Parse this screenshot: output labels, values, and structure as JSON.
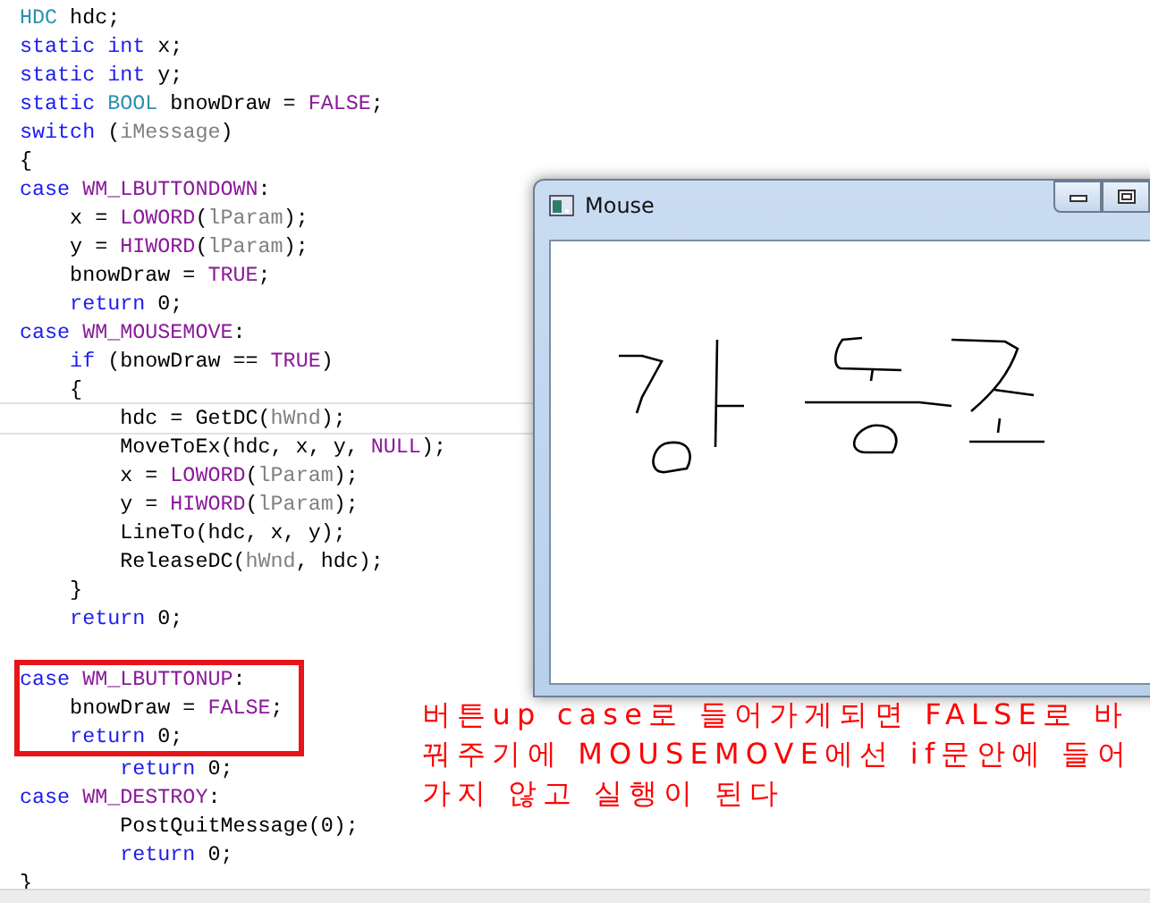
{
  "code": {
    "blocks": [
      {
        "kind": "plain",
        "lines": [
          {
            "current": false,
            "tokens": [
              {
                "kind": "type",
                "text": "HDC"
              },
              {
                "kind": "text",
                "text": " hdc;"
              }
            ]
          },
          {
            "current": false,
            "tokens": [
              {
                "kind": "kw",
                "text": "static int"
              },
              {
                "kind": "text",
                "text": " x;"
              }
            ]
          },
          {
            "current": false,
            "tokens": [
              {
                "kind": "kw",
                "text": "static int"
              },
              {
                "kind": "text",
                "text": " y;"
              }
            ]
          },
          {
            "current": false,
            "tokens": [
              {
                "kind": "kw",
                "text": "static "
              },
              {
                "kind": "type",
                "text": "BOOL"
              },
              {
                "kind": "text",
                "text": " bnowDraw = "
              },
              {
                "kind": "macro",
                "text": "FALSE"
              },
              {
                "kind": "text",
                "text": ";"
              }
            ]
          },
          {
            "current": false,
            "tokens": [
              {
                "kind": "kw",
                "text": "switch"
              },
              {
                "kind": "text",
                "text": " ("
              },
              {
                "kind": "param",
                "text": "iMessage"
              },
              {
                "kind": "text",
                "text": ")"
              }
            ]
          },
          {
            "current": false,
            "tokens": [
              {
                "kind": "text",
                "text": "{"
              }
            ]
          },
          {
            "current": false,
            "tokens": [
              {
                "kind": "kw",
                "text": "case "
              },
              {
                "kind": "macro",
                "text": "WM_LBUTTONDOWN"
              },
              {
                "kind": "text",
                "text": ":"
              }
            ]
          },
          {
            "current": false,
            "tokens": [
              {
                "kind": "text",
                "text": "    x = "
              },
              {
                "kind": "macro",
                "text": "LOWORD"
              },
              {
                "kind": "text",
                "text": "("
              },
              {
                "kind": "param",
                "text": "lParam"
              },
              {
                "kind": "text",
                "text": ");"
              }
            ]
          },
          {
            "current": false,
            "tokens": [
              {
                "kind": "text",
                "text": "    y = "
              },
              {
                "kind": "macro",
                "text": "HIWORD"
              },
              {
                "kind": "text",
                "text": "("
              },
              {
                "kind": "param",
                "text": "lParam"
              },
              {
                "kind": "text",
                "text": ");"
              }
            ]
          },
          {
            "current": false,
            "tokens": [
              {
                "kind": "text",
                "text": "    bnowDraw = "
              },
              {
                "kind": "macro",
                "text": "TRUE"
              },
              {
                "kind": "text",
                "text": ";"
              }
            ]
          },
          {
            "current": false,
            "tokens": [
              {
                "kind": "kw",
                "text": "    return"
              },
              {
                "kind": "text",
                "text": " 0;"
              }
            ]
          },
          {
            "current": false,
            "tokens": [
              {
                "kind": "kw",
                "text": "case "
              },
              {
                "kind": "macro",
                "text": "WM_MOUSEMOVE"
              },
              {
                "kind": "text",
                "text": ":"
              }
            ]
          },
          {
            "current": false,
            "tokens": [
              {
                "kind": "kw",
                "text": "    if"
              },
              {
                "kind": "text",
                "text": " (bnowDraw == "
              },
              {
                "kind": "macro",
                "text": "TRUE"
              },
              {
                "kind": "text",
                "text": ")"
              }
            ]
          },
          {
            "current": false,
            "tokens": [
              {
                "kind": "text",
                "text": "    {"
              }
            ]
          },
          {
            "current": true,
            "tokens": [
              {
                "kind": "text",
                "text": "        hdc = GetDC("
              },
              {
                "kind": "param",
                "text": "hWnd"
              },
              {
                "kind": "text",
                "text": ");"
              }
            ]
          },
          {
            "current": false,
            "tokens": [
              {
                "kind": "text",
                "text": "        MoveToEx(hdc, x, y, "
              },
              {
                "kind": "macro",
                "text": "NULL"
              },
              {
                "kind": "text",
                "text": ");"
              }
            ]
          },
          {
            "current": false,
            "tokens": [
              {
                "kind": "text",
                "text": "        x = "
              },
              {
                "kind": "macro",
                "text": "LOWORD"
              },
              {
                "kind": "text",
                "text": "("
              },
              {
                "kind": "param",
                "text": "lParam"
              },
              {
                "kind": "text",
                "text": ");"
              }
            ]
          },
          {
            "current": false,
            "tokens": [
              {
                "kind": "text",
                "text": "        y = "
              },
              {
                "kind": "macro",
                "text": "HIWORD"
              },
              {
                "kind": "text",
                "text": "("
              },
              {
                "kind": "param",
                "text": "lParam"
              },
              {
                "kind": "text",
                "text": ");"
              }
            ]
          },
          {
            "current": false,
            "tokens": [
              {
                "kind": "text",
                "text": "        LineTo(hdc, x, y);"
              }
            ]
          },
          {
            "current": false,
            "tokens": [
              {
                "kind": "text",
                "text": "        ReleaseDC("
              },
              {
                "kind": "param",
                "text": "hWnd"
              },
              {
                "kind": "text",
                "text": ", hdc);"
              }
            ]
          },
          {
            "current": false,
            "tokens": [
              {
                "kind": "text",
                "text": "    }"
              }
            ]
          },
          {
            "current": false,
            "tokens": [
              {
                "kind": "kw",
                "text": "    return"
              },
              {
                "kind": "text",
                "text": " 0;"
              }
            ]
          }
        ]
      },
      {
        "kind": "boxed",
        "lines": [
          {
            "current": false,
            "tokens": [
              {
                "kind": "kw",
                "text": "case "
              },
              {
                "kind": "macro",
                "text": "WM_LBUTTONUP"
              },
              {
                "kind": "text",
                "text": ":"
              }
            ]
          },
          {
            "current": false,
            "tokens": [
              {
                "kind": "text",
                "text": "    bnowDraw = "
              },
              {
                "kind": "macro",
                "text": "FALSE"
              },
              {
                "kind": "text",
                "text": ";"
              }
            ]
          },
          {
            "current": false,
            "tokens": [
              {
                "kind": "kw",
                "text": "    return"
              },
              {
                "kind": "text",
                "text": " 0;"
              }
            ]
          }
        ]
      },
      {
        "kind": "plain",
        "lines": [
          {
            "current": false,
            "tokens": [
              {
                "kind": "kw",
                "text": "        return"
              },
              {
                "kind": "text",
                "text": " 0;"
              }
            ]
          },
          {
            "current": false,
            "tokens": [
              {
                "kind": "kw",
                "text": "case "
              },
              {
                "kind": "macro",
                "text": "WM_DESTROY"
              },
              {
                "kind": "text",
                "text": ":"
              }
            ]
          },
          {
            "current": false,
            "tokens": [
              {
                "kind": "text",
                "text": "        PostQuitMessage(0);"
              }
            ]
          },
          {
            "current": false,
            "tokens": [
              {
                "kind": "kw",
                "text": "        return"
              },
              {
                "kind": "text",
                "text": " 0;"
              }
            ]
          },
          {
            "current": false,
            "tokens": [
              {
                "kind": "text",
                "text": "}"
              }
            ]
          }
        ]
      }
    ]
  },
  "window": {
    "title": "Mouse"
  },
  "annotation": "버튼up case로 들어가게되면 FALSE로 바꿔주기에 MOUSEMOVE에선 if문안에 들어가지 않고 실행이 된다"
}
